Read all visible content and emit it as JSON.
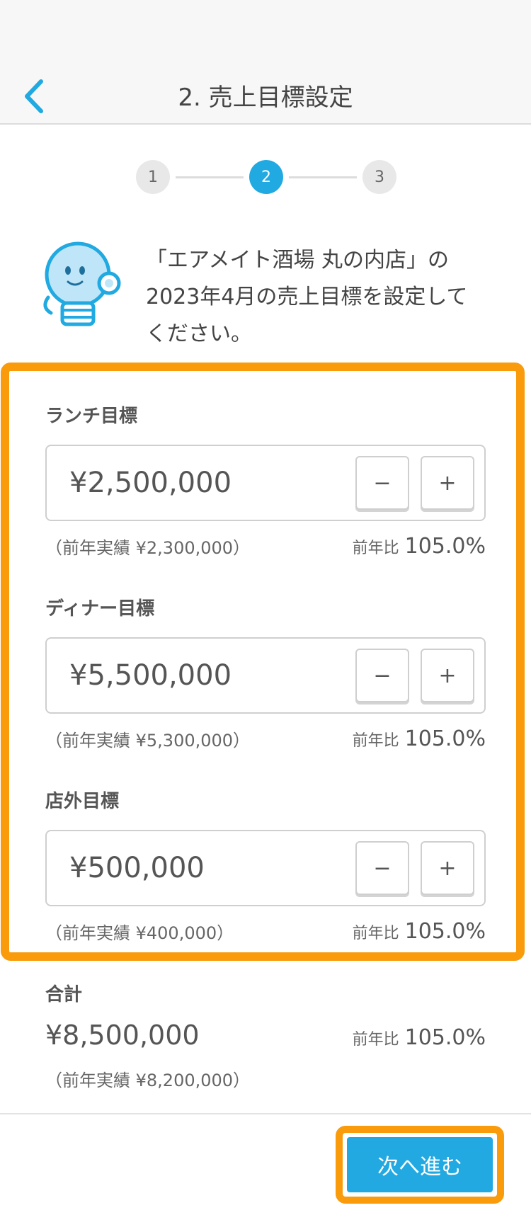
{
  "header": {
    "title": "2. 売上目標設定",
    "back_icon": "chevron-left-icon",
    "accent_color": "#21a9e1"
  },
  "stepper": {
    "steps": [
      "1",
      "2",
      "3"
    ],
    "active_step": "2"
  },
  "intro": {
    "icon": "lightbulb-mascot-icon",
    "text": "「エアメイト酒場 丸の内店」の\n2023年4月の売上目標を設定して\nください。"
  },
  "goals": [
    {
      "label": "ランチ目標",
      "value": "¥2,500,000",
      "previous": "（前年実績 ¥2,300,000）",
      "ratio_label": "前年比",
      "ratio_value": "105.0%",
      "minus": "−",
      "plus": "+"
    },
    {
      "label": "ディナー目標",
      "value": "¥5,500,000",
      "previous": "（前年実績 ¥5,300,000）",
      "ratio_label": "前年比",
      "ratio_value": "105.0%",
      "minus": "−",
      "plus": "+"
    },
    {
      "label": "店外目標",
      "value": "¥500,000",
      "previous": "（前年実績 ¥400,000）",
      "ratio_label": "前年比",
      "ratio_value": "105.0%",
      "minus": "−",
      "plus": "+"
    }
  ],
  "total": {
    "label": "合計",
    "value": "¥8,500,000",
    "ratio_label": "前年比",
    "ratio_value": "105.0%",
    "previous": "（前年実績 ¥8,200,000）"
  },
  "footer": {
    "next_label": "次へ進む"
  },
  "highlight_color": "#f99b0b"
}
